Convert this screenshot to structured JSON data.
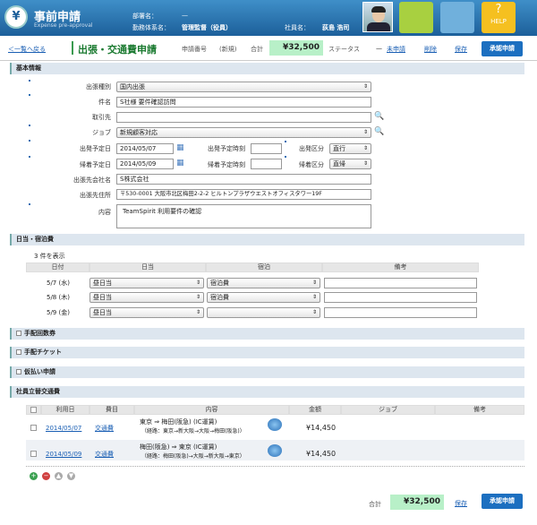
{
  "header": {
    "title": "事前申請",
    "subtitle": "Expense pre-approval",
    "dept_label": "部署名：",
    "dept_value": "—",
    "job_label": "勤務体系名：",
    "job_value": "管理監督（役員）",
    "emp_label": "社員名：",
    "emp_value": "荻島 浩司",
    "help_label": "HELP"
  },
  "toolbar": {
    "back_link": "＜一覧へ戻る",
    "page_title": "出張・交通費申請",
    "req_no_label": "申請番号",
    "req_no_value": "(新規)",
    "total_label": "合計",
    "total_value": "¥32,500",
    "status_label": "ステータス",
    "status_value": "—",
    "unapplied": "未申請",
    "delete": "削除",
    "save": "保存",
    "approve": "承認申請"
  },
  "basic": {
    "title": "基本情報",
    "trip_type_label": "出張種別",
    "trip_type_value": "国内出張",
    "subject_label": "件名",
    "subject_value": "S社様 要件確認訪問",
    "client_label": "取引先",
    "client_value": "",
    "job_label": "ジョブ",
    "job_value": "新規顧客対応",
    "dep_date_label": "出発予定日",
    "dep_date_value": "2014/05/07",
    "dep_time_label": "出発予定時刻",
    "dep_time_value": "",
    "dep_type_label": "出発区分",
    "dep_type_value": "直行",
    "ret_date_label": "帰着予定日",
    "ret_date_value": "2014/05/09",
    "ret_time_label": "帰着予定時刻",
    "ret_time_value": "",
    "ret_type_label": "帰着区分",
    "ret_type_value": "直帰",
    "dest_company_label": "出張先会社名",
    "dest_company_value": "S株式会社",
    "dest_addr_label": "出張先住所",
    "dest_addr_value": "〒530-0001 大阪市北区梅田2-2-2 ヒルトンプラザウエストオフィスタワー19F",
    "content_label": "内容",
    "content_value": "TeamSpirit 利用要件の確認"
  },
  "daily": {
    "title": "日当・宿泊費",
    "count_text": "3 件を表示",
    "headers": [
      "日付",
      "日当",
      "宿泊",
      "備考"
    ],
    "rows": [
      {
        "date": "5/7 (水)",
        "allowance": "昼日当",
        "lodging": "宿泊費",
        "note": ""
      },
      {
        "date": "5/8 (木)",
        "allowance": "昼日当",
        "lodging": "宿泊費",
        "note": ""
      },
      {
        "date": "5/9 (金)",
        "allowance": "昼日当",
        "lodging": "",
        "note": ""
      }
    ]
  },
  "sections": {
    "coupon": "手配回数券",
    "ticket": "手配チケット",
    "advance": "仮払い申請",
    "transport": "社員立替交通費"
  },
  "transport": {
    "headers": [
      "利用日",
      "費目",
      "内容",
      "金額",
      "ジョブ",
      "備考"
    ],
    "rows": [
      {
        "date": "2014/05/07",
        "item": "交通費",
        "route": "東京 ⇒ 梅田(阪急) (IC運賃)",
        "detail": "（経路：東京→新大阪→大阪→梅田(阪急)）",
        "amount": "¥14,450"
      },
      {
        "date": "2014/05/09",
        "item": "交通費",
        "route": "梅田(阪急) ⇒ 東京 (IC運賃)",
        "detail": "（経路：梅田(阪急)→大阪→新大阪→東京）",
        "amount": "¥14,450"
      }
    ]
  },
  "footer": {
    "total_label": "合計",
    "total_value": "¥32,500",
    "save": "保存",
    "approve": "承認申請"
  },
  "colors": {
    "accent": "#1c6fc0",
    "total_bg": "#b8f0c8",
    "header_bg": "#2a74b0",
    "tile_green": "#a8d040",
    "tile_blue": "#70b0dc",
    "tile_help": "#f5c020"
  }
}
